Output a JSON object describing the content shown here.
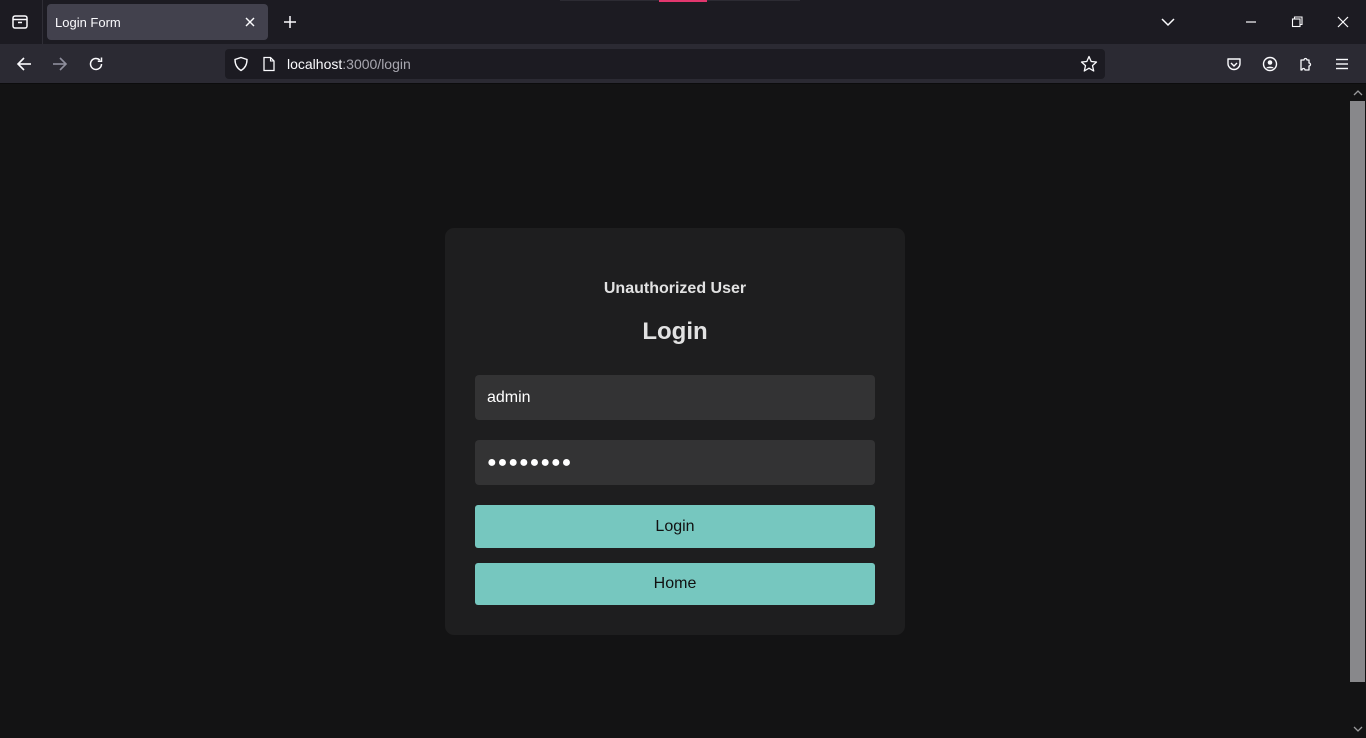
{
  "browser": {
    "tab": {
      "title": "Login Form",
      "close_icon": "close-icon"
    },
    "new_tab_icon": "plus-icon",
    "list_all_tabs_icon": "chevron-down-icon",
    "url": {
      "host": "localhost",
      "path": ":3000/login"
    },
    "toolbar_icons": [
      "pocket-icon",
      "account-icon",
      "extensions-icon",
      "menu-icon"
    ],
    "colors": {
      "tab_active": "#42414d",
      "navbar": "#2b2a33",
      "urlbar": "#1c1b22"
    }
  },
  "login_card": {
    "subtitle": "Unauthorized User",
    "title": "Login",
    "username_value": "admin",
    "password_masked": "●●●●●●●●",
    "login_button": "Login",
    "home_button": "Home",
    "colors": {
      "card": "#1e1e1f",
      "input": "#333334",
      "button": "#76c7bf",
      "text": "#e2e2e2"
    }
  }
}
